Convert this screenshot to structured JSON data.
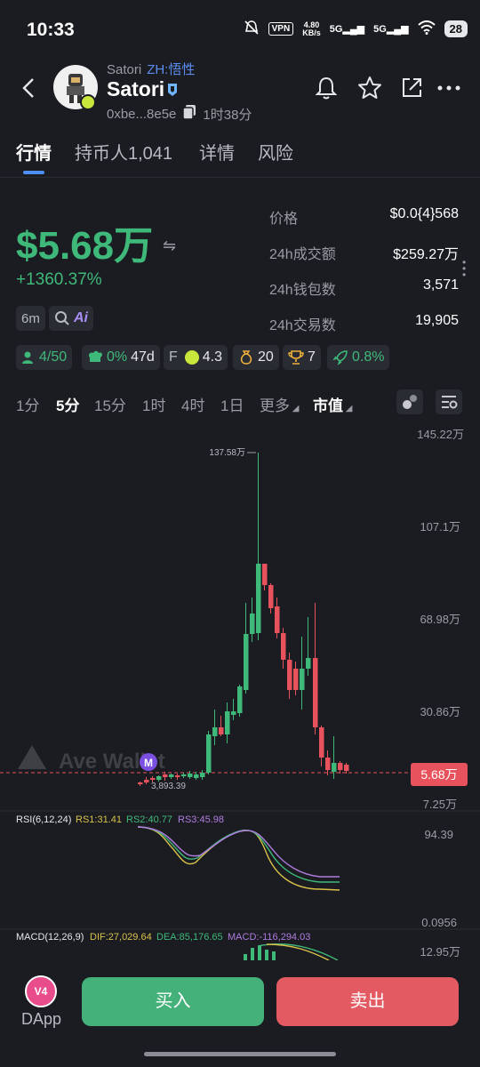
{
  "status_bar": {
    "time": "10:33",
    "vpn": "VPN",
    "speed_top": "4.80",
    "speed_bottom": "KB/s",
    "sig1": "5G",
    "sig2": "5G",
    "battery": "28"
  },
  "header": {
    "sub_name": "Satori",
    "sub_zh": "ZH:悟性",
    "name": "Satori",
    "address": "0xbe...8e5e",
    "age": "1时38分"
  },
  "tabs": [
    {
      "label": "行情"
    },
    {
      "label": "持币人1,041"
    },
    {
      "label": "详情"
    },
    {
      "label": "风险"
    }
  ],
  "price": {
    "big": "$5.68万",
    "change": "+1360.37%"
  },
  "stats": [
    {
      "label": "价格",
      "value": "$0.0{4}568"
    },
    {
      "label": "24h成交额",
      "value": "$259.27万"
    },
    {
      "label": "24h钱包数",
      "value": "3,571"
    },
    {
      "label": "24h交易数",
      "value": "19,905"
    }
  ],
  "tags": {
    "time": "6m",
    "ai": "Ai"
  },
  "chips": {
    "holders": "4/50",
    "dev": "0%",
    "dev_age": "47d",
    "f_label": "F",
    "f_score": "4.3",
    "bag": "20",
    "trophy": "7",
    "rocket": "0.8%"
  },
  "intervals": {
    "items": [
      "1分",
      "5分",
      "15分",
      "1时",
      "4时",
      "1日",
      "更多"
    ],
    "active": "5分",
    "metric": "市值"
  },
  "chart": {
    "y_labels": [
      "145.22万",
      "107.1万",
      "68.98万",
      "30.86万",
      "7.25万"
    ],
    "max_label": "137.58万",
    "min_label": "3,893.39",
    "current": "5.68万",
    "watermark": "Ave Wallet",
    "marker": "M"
  },
  "rsi": {
    "title": "RSI(6,12,24)",
    "rs1": "RS1:31.41",
    "rs2": "RS2:40.77",
    "rs3": "RS3:45.98",
    "top": "94.39",
    "bottom": "0.0956"
  },
  "macd": {
    "title": "MACD(12,26,9)",
    "dif": "DIF:27,029.64",
    "dea": "DEA:85,176.65",
    "macd": "MACD:-116,294.03",
    "top": "12.95万"
  },
  "bottom": {
    "dapp": "DApp",
    "dapp_badge": "V4",
    "buy": "买入",
    "sell": "卖出"
  },
  "colors": {
    "up": "#3fb97a",
    "down": "#e8525d",
    "accent": "#4e8ff5"
  }
}
